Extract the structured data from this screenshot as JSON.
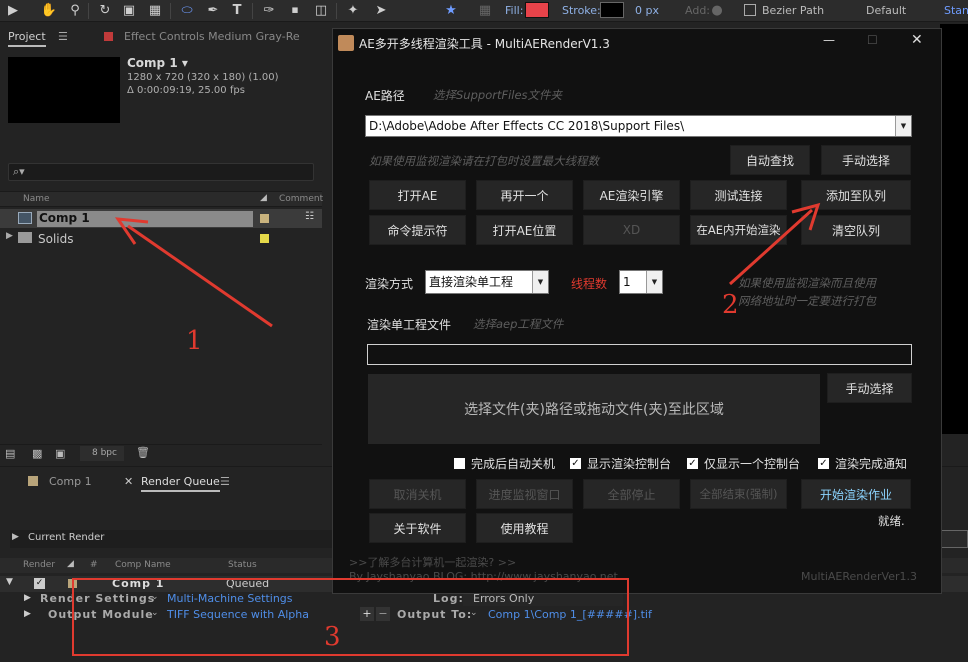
{
  "toolbar": {
    "fill_label": "Fill:",
    "stroke_label": "Stroke:",
    "stroke_px": "0 px",
    "add_label": "Add:",
    "bezier_label": "Bezier Path",
    "workspace": "Default",
    "workspace2": "Stan",
    "fill_color": "#e8434a"
  },
  "project_panel": {
    "tab": "Project",
    "tab2": "Effect Controls Medium Gray-Re",
    "comp_name": "Comp 1 ▾",
    "comp_info1": "1280 x 720  (320 x 180) (1.00)",
    "comp_info2": "Δ 0:00:09:19, 25.00 fps",
    "search_icon": "⌕▾",
    "col_name": "Name",
    "col_comment": "Comment",
    "items": [
      {
        "label": "Comp 1",
        "color": "#c9b37e"
      },
      {
        "label": "Solids",
        "color": "#e5d94a"
      }
    ],
    "bpc": "8 bpc"
  },
  "tabs_lower": {
    "comp_tab": "Comp 1",
    "rq_tab": "Render Queue"
  },
  "render_queue": {
    "current_render": "Current Render",
    "col_render": "Render",
    "col_hash": "#",
    "col_comp": "Comp Name",
    "col_status": "Status",
    "row_comp": "Comp 1",
    "row_status": "Queued",
    "render_settings_label": "Render Settings",
    "render_settings_value": "Multi-Machine Settings",
    "log_label": "Log:",
    "log_value": "Errors Only",
    "output_module_label": "Output Module",
    "output_module_value": "TIFF Sequence with Alpha",
    "output_to_label": "Output To:",
    "output_to_value": "Comp 1\\Comp 1_[#####].tif"
  },
  "dialog": {
    "title": "AE多开多线程渲染工具 - MultiAERenderV1.3",
    "ae_path_label": "AE路径",
    "ae_path_hint": "选择SupportFiles文件夹",
    "ae_path_value": "D:\\Adobe\\Adobe After Effects CC 2018\\Support Files\\",
    "monitor_hint": "如果使用监视渲染请在打包时设置最大线程数",
    "btn_auto_find": "自动查找",
    "btn_manual_select": "手动选择",
    "row1": [
      "打开AE",
      "再开一个",
      "AE渲染引擎",
      "测试连接",
      "添加至队列"
    ],
    "row2": [
      "命令提示符",
      "打开AE位置",
      "XD",
      "在AE内开始渲染",
      "清空队列"
    ],
    "render_mode_label": "渲染方式",
    "render_mode_value": "直接渲染单工程",
    "threads_label": "线程数",
    "threads_value": "1",
    "note_line1": "如果使用监视渲染而且使用",
    "note_line2": "网络地址时一定要进行打包",
    "single_file_label": "渲染单工程文件",
    "single_file_hint": "选择aep工程文件",
    "drop_zone": "选择文件(夹)路径或拖动文件(夹)至此区域",
    "btn_manual_select2": "手动选择",
    "checks": [
      "完成后自动关机",
      "显示渲染控制台",
      "仅显示一个控制台",
      "渲染完成通知"
    ],
    "row3": [
      "取消关机",
      "进度监视窗口",
      "全部停止",
      "全部结束(强制)",
      "开始渲染作业"
    ],
    "btn_about": "关于软件",
    "btn_tutorial": "使用教程",
    "status": "就绪.",
    "footer_link": ">>了解多台计算机一起渲染? >>",
    "footer_by": "By Jayshanyao  BLOG: http://www.jayshanyao.net",
    "footer_version": "MultiAERenderVer1.3"
  },
  "annotations": {
    "n1": "1",
    "n2": "2",
    "n3": "3",
    "color": "#e03a2f"
  }
}
